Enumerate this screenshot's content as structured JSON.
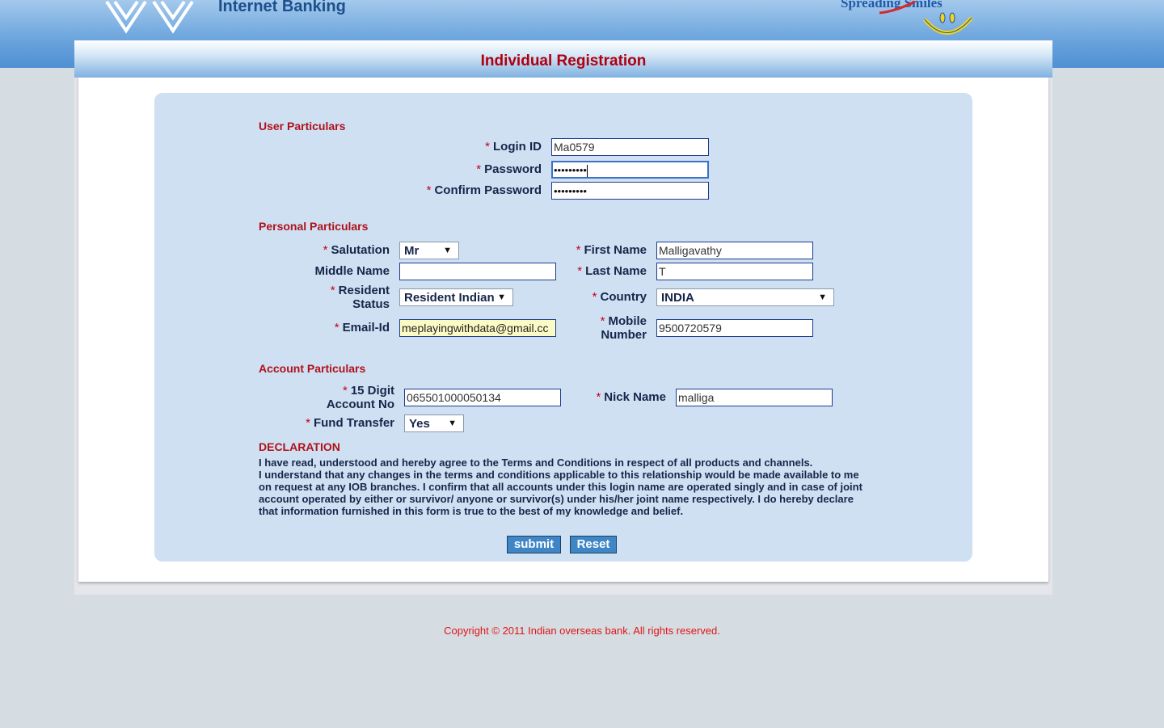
{
  "header": {
    "app_title": "Internet Banking",
    "tagline": "Spreading Smiles"
  },
  "page_title": "Individual Registration",
  "required_mark": "*",
  "user_particulars": {
    "heading": "User Particulars",
    "login_id": {
      "label": "Login ID",
      "value": "Ma0579"
    },
    "password": {
      "label": "Password",
      "value": "•••••••••"
    },
    "confirm_password": {
      "label": "Confirm Password",
      "value": "•••••••••"
    }
  },
  "personal_particulars": {
    "heading": "Personal Particulars",
    "salutation": {
      "label": "Salutation",
      "value": "Mr"
    },
    "middle_name": {
      "label": "Middle Name",
      "value": ""
    },
    "resident_status": {
      "label_line1": "Resident",
      "label_line2": "Status",
      "value": "Resident Indian"
    },
    "email": {
      "label": "Email-Id",
      "value": "meplayingwithdata@gmail.cc"
    },
    "first_name": {
      "label": "First Name",
      "value": "Malligavathy"
    },
    "last_name": {
      "label": "Last Name",
      "value": "T"
    },
    "country": {
      "label": "Country",
      "value": "INDIA"
    },
    "mobile": {
      "label_line1": "Mobile",
      "label_line2": "Number",
      "value": "9500720579"
    }
  },
  "account_particulars": {
    "heading": "Account Particulars",
    "account_no": {
      "label_line1": "15 Digit",
      "label_line2": "Account No",
      "value": "065501000050134"
    },
    "fund_transfer": {
      "label": "Fund Transfer",
      "value": "Yes"
    },
    "nick_name": {
      "label": "Nick Name",
      "value": "malliga"
    }
  },
  "declaration": {
    "heading": "DECLARATION",
    "line1": "I have read, understood and hereby agree to the Terms and Conditions in respect of all products and channels.",
    "line2": "I understand that any changes in the terms and conditions applicable to this relationship would be made available to me on request at any IOB branches. I confirm that all accounts under this login name are operated singly and in case of joint account operated by either or survivor/ anyone or survivor(s) under his/her joint name respectively. I do hereby declare that information furnished in this form is true to the best of my knowledge and belief."
  },
  "buttons": {
    "submit": "submit",
    "reset": "Reset"
  },
  "footer": {
    "copyright": "Copyright © 2011 Indian overseas bank. All rights reserved."
  },
  "colors": {
    "header_blue": "#4f8fd3",
    "title_red": "#b00010",
    "card_bg": "#cfe0f2",
    "button_blue": "#3e86c6",
    "copyright_red": "#e01515"
  }
}
